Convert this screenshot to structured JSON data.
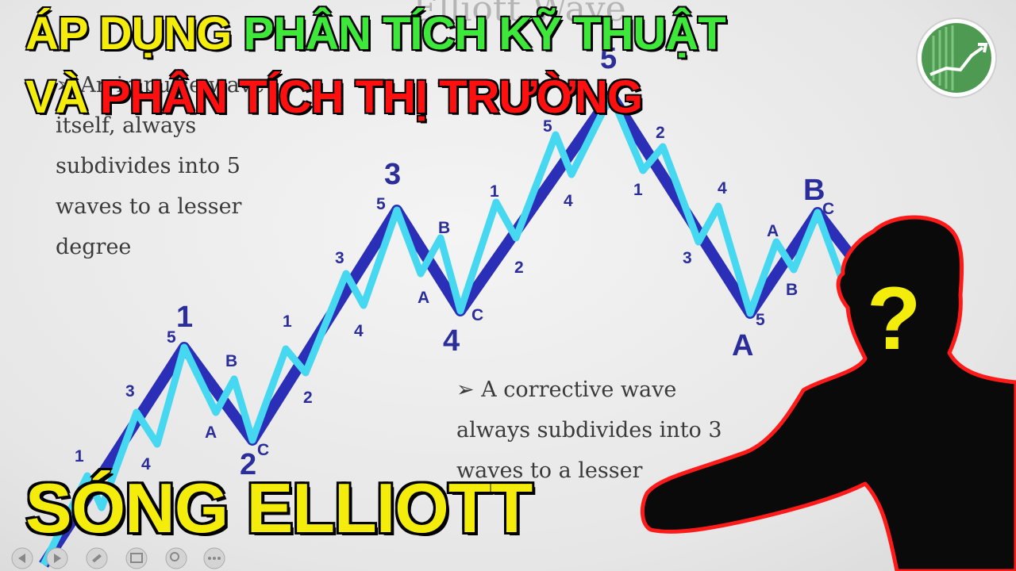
{
  "headline": {
    "line1_part1": "ÁP DỤNG ",
    "line1_part2": "PHÂN TÍCH KỸ THUẬT",
    "line2_part1": "VÀ ",
    "line2_part2": "PHÂN TÍCH THỊ TRƯỜNG"
  },
  "bottom_title": "SÓNG ELLIOTT",
  "slide": {
    "title": "Elliott Wave",
    "text_left": [
      "➢ An impulse wave",
      "itself, always",
      "subdivides into 5",
      "waves to a lesser",
      "degree"
    ],
    "text_right": [
      "➢ A corrective wave",
      "always subdivides into 3",
      "waves to a lesser"
    ]
  },
  "wave_labels": {
    "major": [
      "1",
      "2",
      "3",
      "4",
      "5",
      "A",
      "B"
    ],
    "minor": [
      "1",
      "3",
      "4",
      "5",
      "A",
      "B",
      "C",
      "1",
      "2",
      "3",
      "4",
      "5",
      "A",
      "B",
      "C",
      "1",
      "2",
      "4",
      "5",
      "1",
      "2",
      "3",
      "4",
      "A",
      "B",
      "5",
      "C"
    ]
  },
  "silhouette_mark": "?",
  "colors": {
    "headline_yellow": "#f4ec0a",
    "headline_green": "#3ee83a",
    "headline_red": "#ff1010",
    "wave_dark": "#2b2fb8",
    "wave_light": "#46d8f0",
    "logo_green": "#4e9a52"
  },
  "icons": [
    "logo-chart-icon",
    "question-mark-icon",
    "prev-slide-icon",
    "next-slide-icon",
    "pen-icon",
    "slides-icon",
    "zoom-icon",
    "more-icon"
  ]
}
